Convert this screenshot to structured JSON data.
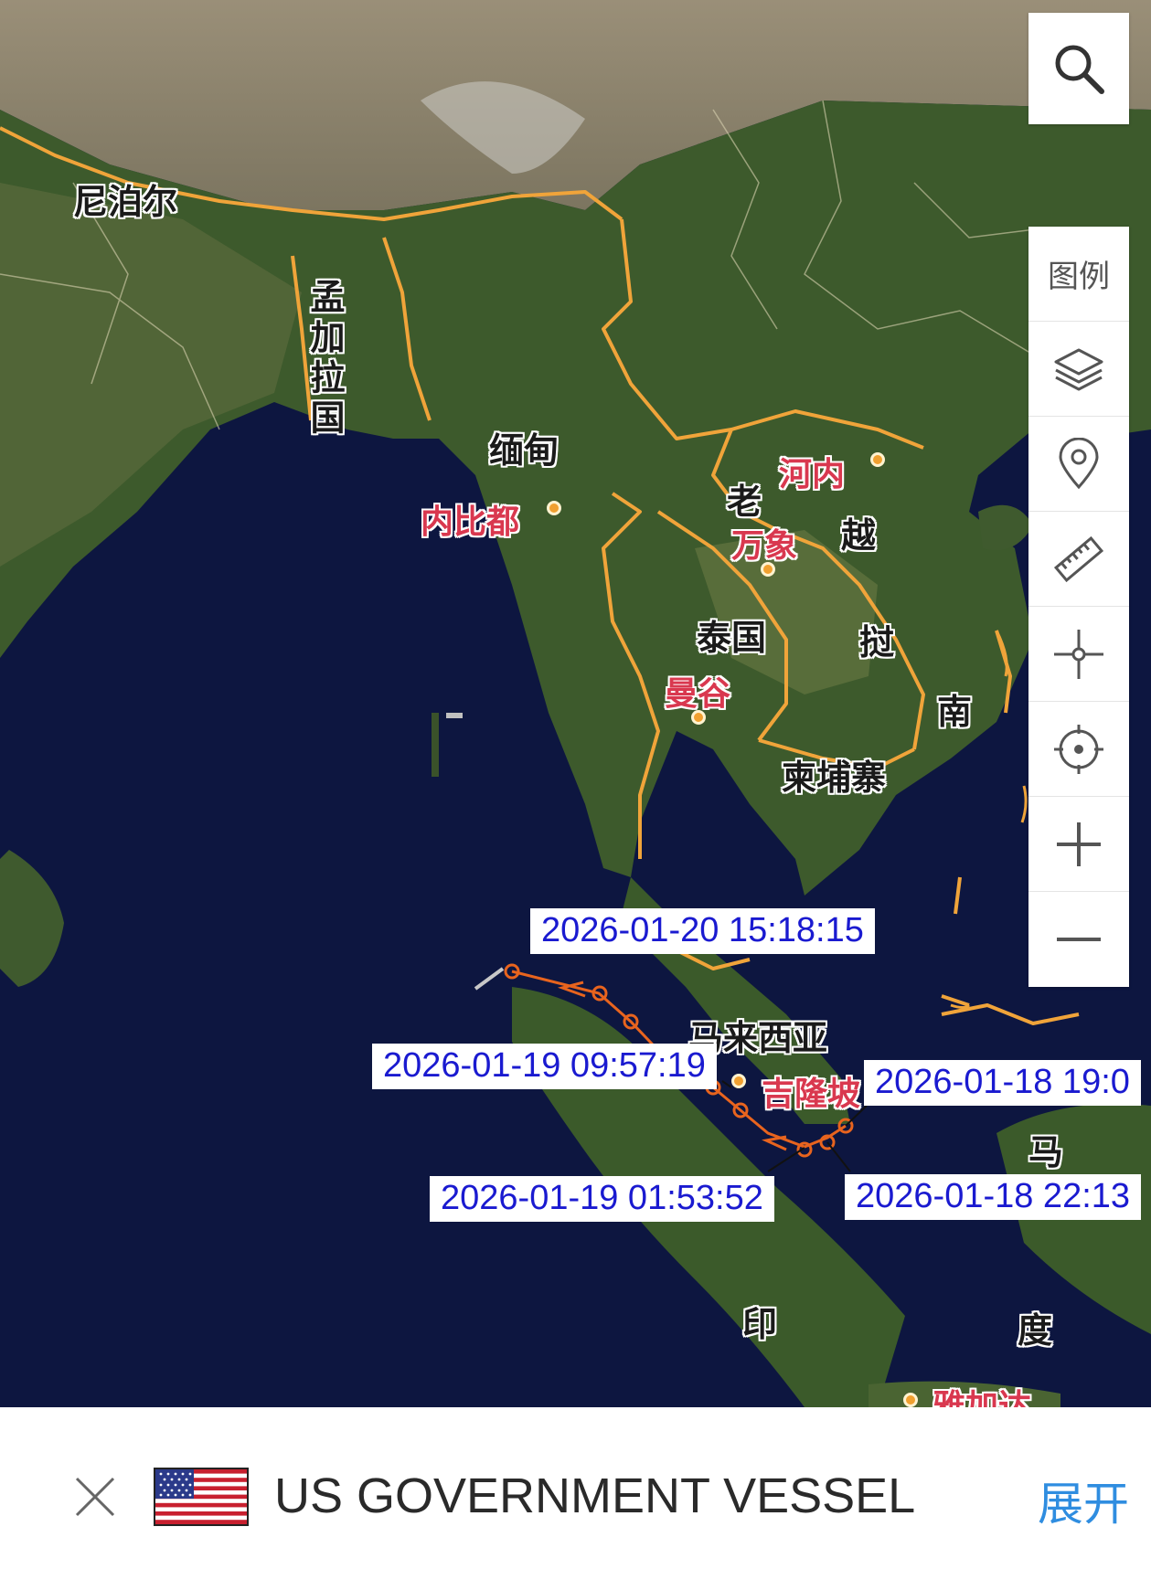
{
  "map": {
    "country_labels": {
      "nepal": "尼泊尔",
      "bangladesh": "孟加拉国",
      "myanmar": "缅甸",
      "laos_1": "老",
      "vietnam_1": "越",
      "thailand": "泰国",
      "vietnam_2": "挝",
      "vietnam_3": "南",
      "cambodia": "柬埔寨",
      "malaysia": "马来西亚",
      "malaysia_2": "马",
      "indonesia_1": "印",
      "indonesia_2": "度"
    },
    "city_labels": {
      "naypyidaw": "内比都",
      "hanoi": "河内",
      "vientiane": "万象",
      "bangkok": "曼谷",
      "kuala_lumpur": "吉隆坡",
      "jakarta": "雅加达"
    },
    "track_timestamps": [
      "2026-01-20 15:18:15",
      "2026-01-19 09:57:19",
      "2026-01-18 19:0",
      "2026-01-19 01:53:52",
      "2026-01-18 22:13"
    ],
    "colors": {
      "track": "#e8641e",
      "border": "#f0a43a",
      "ocean": "#0d1640",
      "land": "#3d5a2c",
      "label_text": "#1a1ad0"
    }
  },
  "toolbar": {
    "search_icon": "search-icon",
    "legend_label": "图例",
    "tools": [
      "layers-icon",
      "location-pin-icon",
      "ruler-icon",
      "center-point-icon",
      "locate-icon",
      "zoom-in-icon",
      "zoom-out-icon"
    ]
  },
  "vessel": {
    "flag": "us-flag-icon",
    "name": "US GOVERNMENT VESSEL",
    "expand_label": "展开"
  }
}
